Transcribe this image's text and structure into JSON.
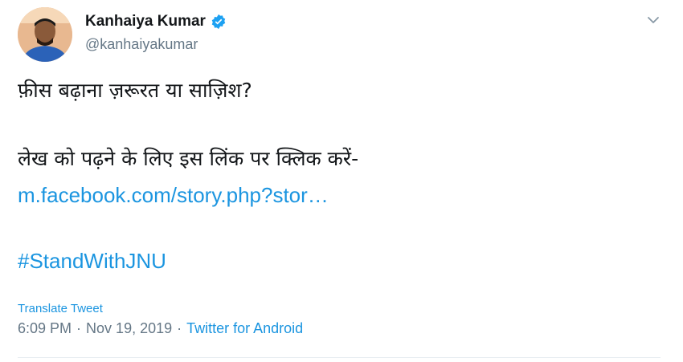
{
  "author": {
    "display_name": "Kanhaiya Kumar",
    "handle": "@kanhaiyakumar",
    "verified_icon": "verified-badge-icon",
    "avatar_icon": "user-avatar"
  },
  "tweet": {
    "line1": "फ़ीस बढ़ाना ज़रूरत या साज़िश?",
    "line2": "लेख को पढ़ने के लिए इस लिंक पर क्लिक करें-",
    "link": "m.facebook.com/story.php?stor…",
    "hashtag": "#StandWithJNU"
  },
  "footer": {
    "translate": "Translate Tweet",
    "time": "6:09 PM",
    "separator": "·",
    "date": "Nov 19, 2019",
    "source": "Twitter for Android"
  },
  "colors": {
    "link": "#1b95e0",
    "muted": "#657786",
    "text": "#14171a"
  }
}
